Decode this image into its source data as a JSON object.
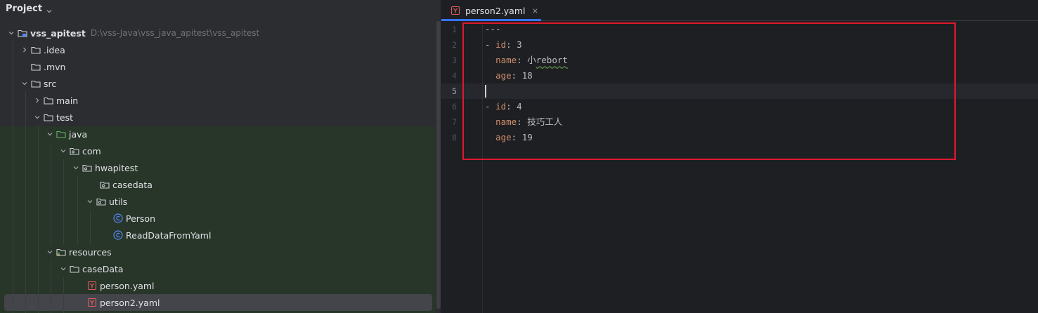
{
  "panel": {
    "title": "Project"
  },
  "tree": {
    "root": {
      "label": "vss_apitest",
      "path": "D:\\vss-Java\\vss_java_apitest\\vss_apitest"
    },
    "idea": "idea",
    "mvn": ".mvn",
    "src": "src",
    "main": "main",
    "test": "test",
    "java": "java",
    "com": "com",
    "hwapitest": "hwapitest",
    "casedata": "casedata",
    "utils": "utils",
    "person_class": "Person",
    "read_class": "ReadDataFromYaml",
    "resources": "resources",
    "caseData": "caseData",
    "person_yaml": "person.yaml",
    "person2_yaml": "person2.yaml"
  },
  "editor": {
    "tab_label": "person2.yaml",
    "line_numbers": [
      "1",
      "2",
      "3",
      "4",
      "5",
      "6",
      "7",
      "8"
    ],
    "lines": {
      "l1": "---",
      "l2_dash": "- ",
      "l2_key": "id",
      "l2_val": ": 3",
      "l3_key": "name",
      "l3_sep": ": ",
      "l3_val_cn": "小",
      "l3_val_en": "rebort",
      "l4_key": "age",
      "l4_val": ": 18",
      "l6_dash": "- ",
      "l6_key": "id",
      "l6_val": ": 4",
      "l7_key": "name",
      "l7_val": ": 技巧工人",
      "l8_key": "age",
      "l8_val": ": 19"
    }
  },
  "colors": {
    "accent": "#3574f0",
    "highlight_box": "#e0182d",
    "yaml_icon": "#db5c5c",
    "class_icon": "#548af7"
  }
}
